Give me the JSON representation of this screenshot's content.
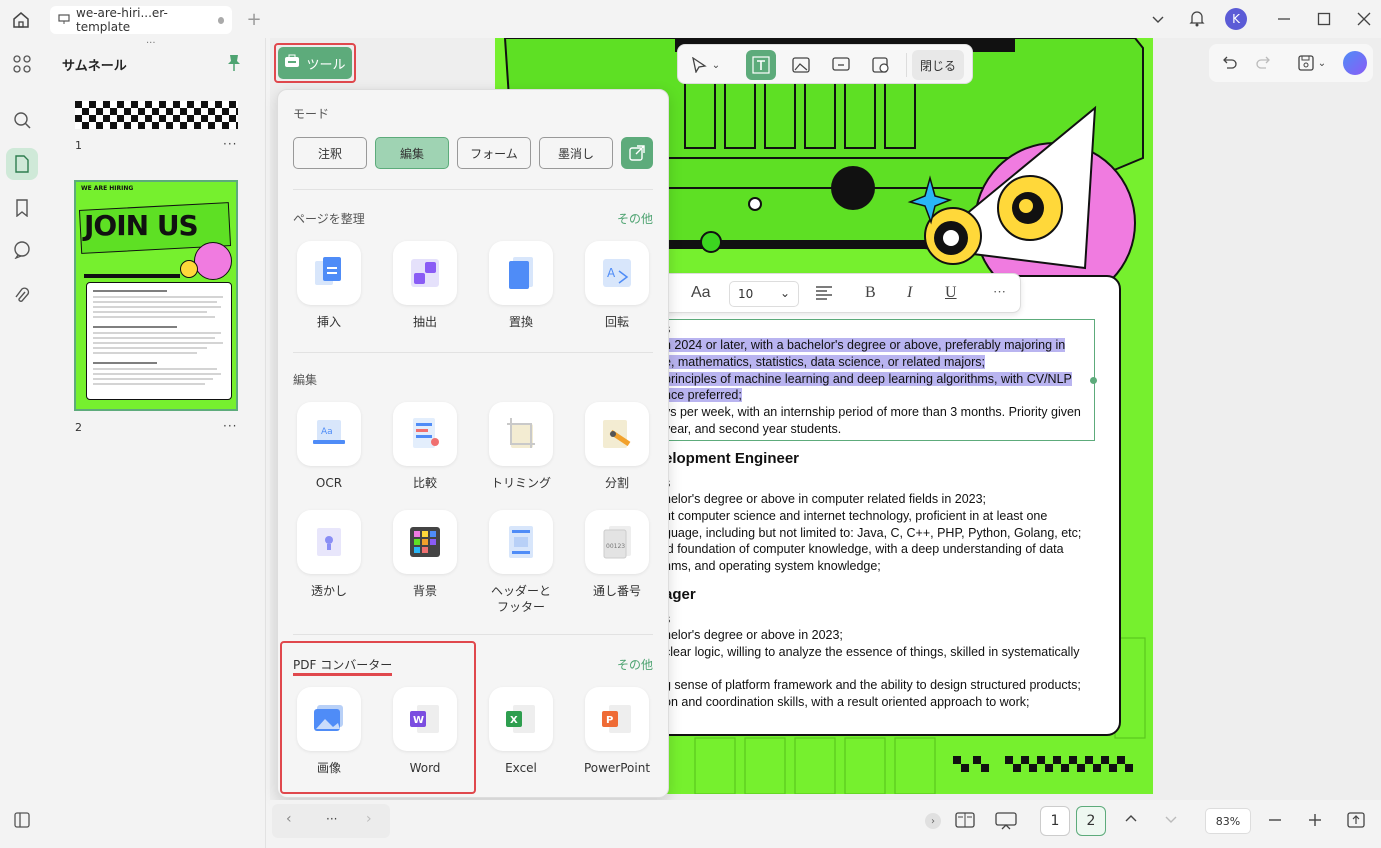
{
  "tab": {
    "title": "we-are-hiri...er-template"
  },
  "avatar": {
    "initial": "K"
  },
  "thumbnails": {
    "title": "サムネール",
    "pages": [
      {
        "number": "1"
      },
      {
        "number": "2"
      }
    ],
    "more": "···",
    "thumb2_header": "WE ARE HIRING",
    "thumb2_banner": "JOIN US"
  },
  "tool_button": {
    "label": "ツール"
  },
  "doc_toolbar": {
    "close_label": "閉じる"
  },
  "format_bar": {
    "font_label": "Aa",
    "font_size": "10",
    "bold": "B",
    "italic": "I",
    "underline": "U",
    "more": "···"
  },
  "popup": {
    "mode": {
      "title": "モード",
      "buttons": [
        "注釈",
        "編集",
        "フォーム",
        "墨消し"
      ],
      "active": "編集"
    },
    "organize": {
      "title": "ページを整理",
      "more": "その他",
      "items": [
        "挿入",
        "抽出",
        "置換",
        "回転"
      ]
    },
    "edit": {
      "title": "編集",
      "items": [
        "OCR",
        "比較",
        "トリミング",
        "分割",
        "透かし",
        "背景",
        "ヘッダーと",
        "通し番号"
      ],
      "item_sub": "フッター"
    },
    "converter": {
      "title": "PDF コンバーター",
      "more": "その他",
      "items": [
        "画像",
        "Word",
        "Excel",
        "PowerPoint"
      ]
    }
  },
  "document": {
    "lines": [
      "s",
      "n 2024 or later, with a bachelor's degree or above, preferably majoring in",
      "e, mathematics, statistics, data science, or related majors;",
      "principles of machine learning and deep learning algorithms, with CV/NLP",
      "nce preferred;",
      "ys per week, with an internship period of more than 3 months. Priority given",
      "year, and second year students."
    ],
    "heading2": "elopment Engineer",
    "lines2": [
      "s",
      "helor's degree or above in computer related fields in 2023;",
      "ut computer science and internet technology, proficient in at least one",
      "guage, including but not limited to: Java, C, C++, PHP, Python, Golang, etc;",
      "id foundation of computer knowledge, with a deep understanding of data",
      "hms, and operating system knowledge;"
    ],
    "heading3": "ager",
    "lines3": [
      "s",
      "helor's degree or above in 2023;",
      "clear logic, willing to analyze the essence of things, skilled in systematically",
      "",
      "g sense of platform framework and the ability to design structured products;",
      "on and coordination skills, with a result oriented approach to work;"
    ]
  },
  "pager": {
    "page1": "1",
    "page2": "2",
    "zoom": "83%",
    "nav_more": "···"
  },
  "colors": {
    "accent": "#5dab7b",
    "highlight_red": "#e0484d",
    "page_green": "#76f02e"
  }
}
